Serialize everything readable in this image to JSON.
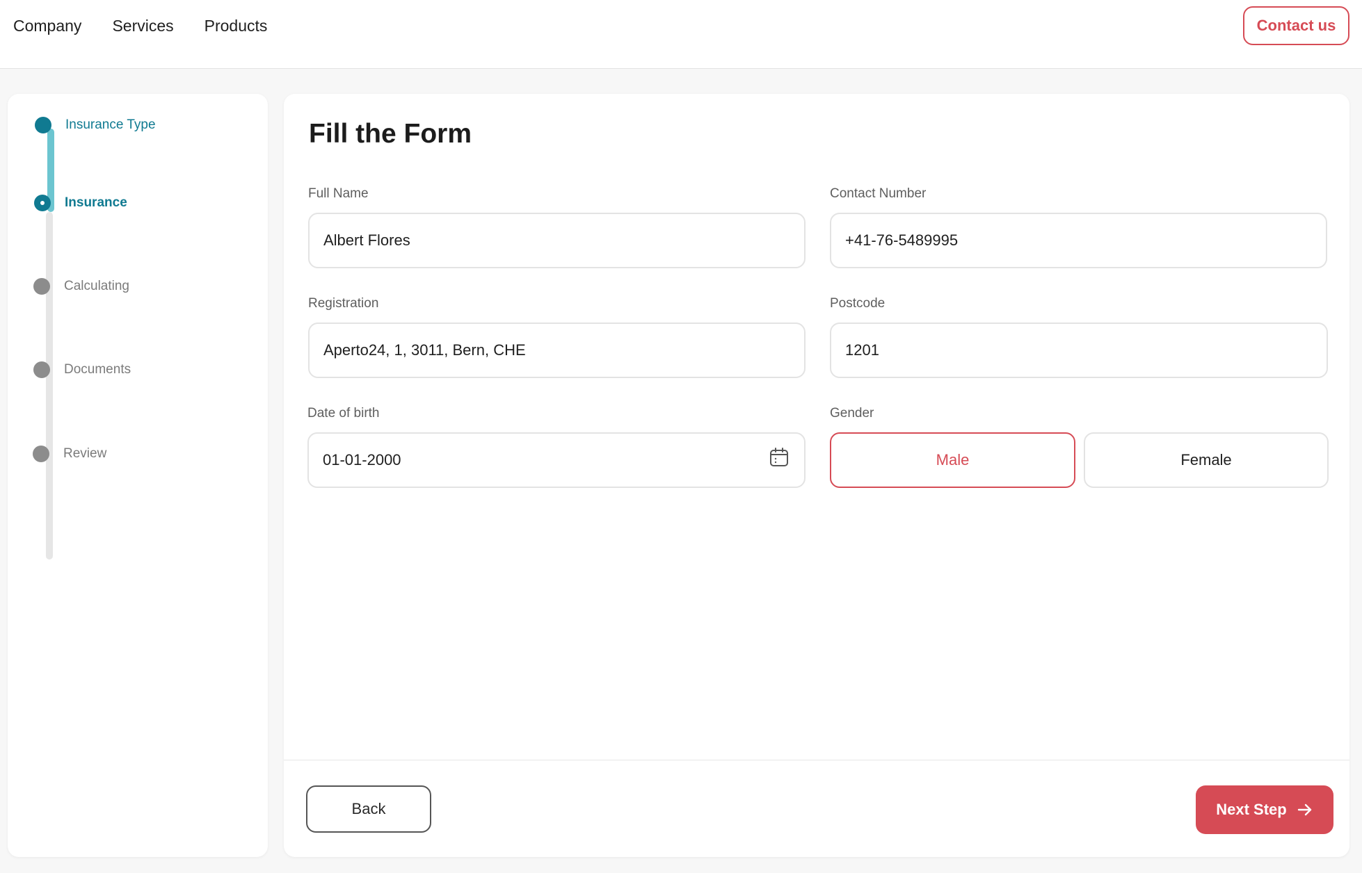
{
  "nav": {
    "links": [
      "Company",
      "Services",
      "Products"
    ],
    "contact_label": "Contact us"
  },
  "stepper": {
    "steps": [
      {
        "label": "Insurance Type",
        "state": "done"
      },
      {
        "label": "Insurance",
        "state": "current"
      },
      {
        "label": "Calculating",
        "state": "pending"
      },
      {
        "label": "Documents",
        "state": "pending"
      },
      {
        "label": "Review",
        "state": "pending"
      }
    ]
  },
  "form": {
    "title": "Fill the Form",
    "full_name": {
      "label": "Full Name",
      "value": "Albert Flores"
    },
    "contact_number": {
      "label": "Contact Number",
      "value": "+41-76-5489995"
    },
    "registration": {
      "label": "Registration",
      "value": "Aperto24, 1, 3011, Bern, CHE"
    },
    "postcode": {
      "label": "Postcode",
      "value": "1201"
    },
    "dob": {
      "label": "Date of birth",
      "value": "01-01-2000"
    },
    "gender": {
      "label": "Gender",
      "options": [
        "Male",
        "Female"
      ],
      "selected": "Male"
    }
  },
  "footer": {
    "back_label": "Back",
    "next_label": "Next Step"
  },
  "colors": {
    "accent": "#d64b55",
    "step_active": "#107a91",
    "step_track_done": "#6cc5d0",
    "step_pending": "#8c8c8c"
  },
  "icons": {
    "dob_icon": "calendar-icon",
    "next_icon": "arrow-right-icon"
  }
}
